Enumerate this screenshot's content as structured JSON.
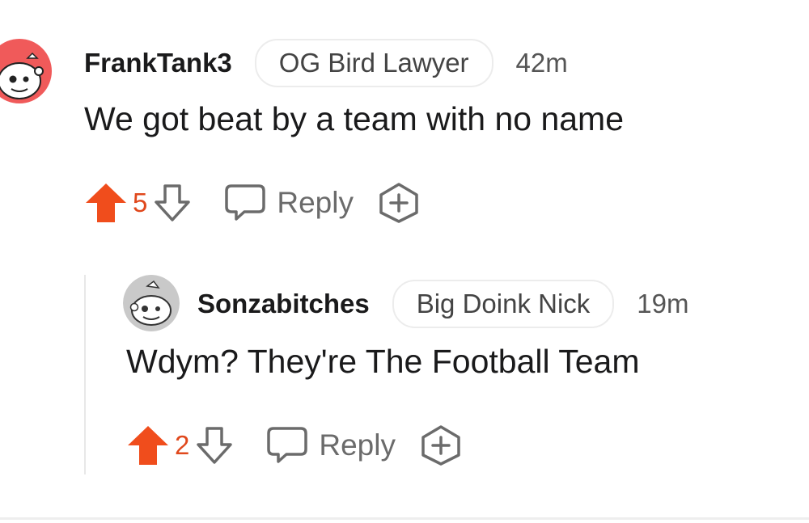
{
  "comments": [
    {
      "username": "FrankTank3",
      "flair": "OG Bird Lawyer",
      "timestamp": "42m",
      "body": "We got beat by a team with no name",
      "score": "5",
      "reply_label": "Reply",
      "avatar_color": "#f05a5a",
      "upvote_active": true
    },
    {
      "username": "Sonzabitches",
      "flair": "Big Doink Nick",
      "timestamp": "19m",
      "body": "Wdym? They're The Football Team",
      "score": "2",
      "reply_label": "Reply",
      "avatar_color": "#c9c9c9",
      "upvote_active": true
    }
  ],
  "colors": {
    "upvote": "#f04d1c",
    "score": "#e0481c",
    "icon_gray": "#6b6b6b"
  }
}
